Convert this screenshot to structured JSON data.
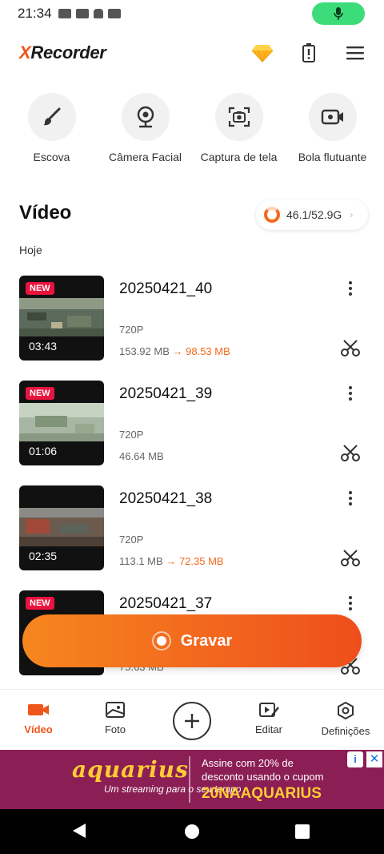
{
  "status_bar": {
    "time": "21:34"
  },
  "header": {
    "logo_x": "X",
    "logo_rest": "Recorder"
  },
  "tools": [
    {
      "label": "Escova",
      "icon": "brush-icon"
    },
    {
      "label": "Câmera Facial",
      "icon": "webcam-icon"
    },
    {
      "label": "Captura de tela",
      "icon": "screenshot-camera-icon"
    },
    {
      "label": "Bola flutuante",
      "icon": "floating-camera-icon"
    }
  ],
  "section": {
    "title": "Vídeo",
    "storage": "46.1/52.9G",
    "day": "Hoje"
  },
  "videos": [
    {
      "badge": "NEW",
      "duration": "03:43",
      "name": "20250421_40",
      "resolution": "720P",
      "size": "153.92 MB",
      "compressed": "98.53 MB"
    },
    {
      "badge": "NEW",
      "duration": "01:06",
      "name": "20250421_39",
      "resolution": "720P",
      "size": "46.64 MB",
      "compressed": ""
    },
    {
      "badge": "",
      "duration": "02:35",
      "name": "20250421_38",
      "resolution": "720P",
      "size": "113.1 MB",
      "compressed": "72.35 MB"
    },
    {
      "badge": "NEW",
      "duration": "",
      "name": "20250421_37",
      "resolution": "",
      "size": "75.63 MB",
      "compressed": ""
    }
  ],
  "record_button": {
    "label": "Gravar"
  },
  "bottom_nav": [
    {
      "label": "Vídeo",
      "icon": "video-camera-icon",
      "active": true
    },
    {
      "label": "Foto",
      "icon": "photo-icon",
      "active": false
    },
    {
      "label": "",
      "icon": "plus-icon",
      "active": false
    },
    {
      "label": "Editar",
      "icon": "edit-icon",
      "active": false
    },
    {
      "label": "Definições",
      "icon": "settings-hex-icon",
      "active": false
    }
  ],
  "ad": {
    "brand": "aquarius",
    "tagline": "Um streaming para o seu tempo",
    "offer_line1": "Assine com 20% de",
    "offer_line2": "desconto usando o cupom",
    "code": "20NAAQUARIUS"
  },
  "colors": {
    "accent": "#f0561b",
    "badge": "#e8133e",
    "ad_bg": "#8b1e54"
  }
}
